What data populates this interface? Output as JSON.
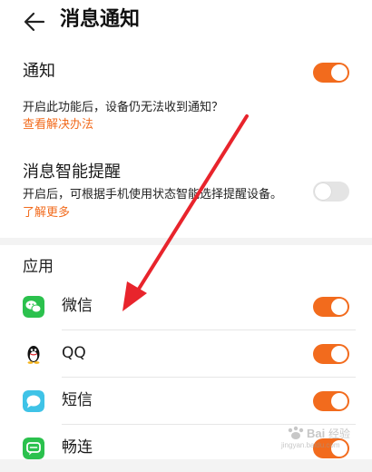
{
  "header": {
    "title": "消息通知",
    "back_icon": "arrow-left-icon"
  },
  "notification": {
    "label": "通知",
    "toggle_on": true,
    "description": "开启此功能后，设备仍无法收到通知？",
    "link": "查看解决办法"
  },
  "smart_reminder": {
    "label": "消息智能提醒",
    "toggle_on": false,
    "description": "开启后，可根据手机使用状态智能选择提醒设备。",
    "link": "了解更多"
  },
  "apps_section": {
    "label": "应用",
    "items": [
      {
        "name": "微信",
        "icon": "wechat-icon",
        "toggle_on": true
      },
      {
        "name": "QQ",
        "icon": "qq-penguin-icon",
        "toggle_on": true
      },
      {
        "name": "短信",
        "icon": "sms-message-icon",
        "toggle_on": true
      },
      {
        "name": "畅连",
        "icon": "meetime-chat-icon",
        "toggle_on": true
      }
    ]
  },
  "colors": {
    "accent": "#f26b1d",
    "toggle_off": "#e4e4e4",
    "annotation_arrow": "#e8242c"
  },
  "watermark": {
    "text": "Baidu经验",
    "url": "jingyan.baidu.com"
  }
}
